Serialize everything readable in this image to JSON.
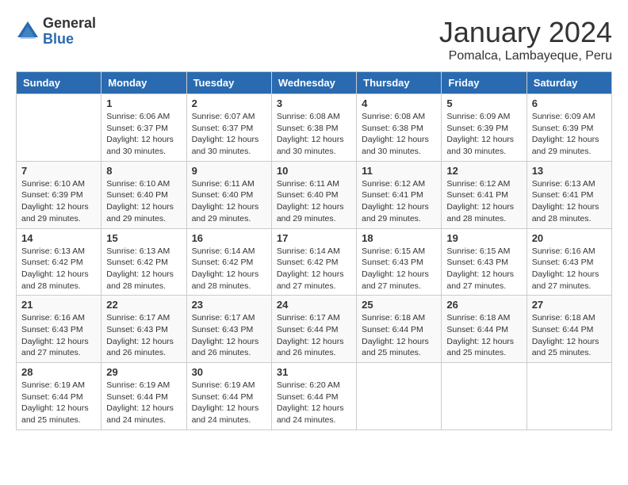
{
  "logo": {
    "general": "General",
    "blue": "Blue"
  },
  "title": "January 2024",
  "subtitle": "Pomalca, Lambayeque, Peru",
  "headers": [
    "Sunday",
    "Monday",
    "Tuesday",
    "Wednesday",
    "Thursday",
    "Friday",
    "Saturday"
  ],
  "weeks": [
    [
      {
        "day": "",
        "info": ""
      },
      {
        "day": "1",
        "info": "Sunrise: 6:06 AM\nSunset: 6:37 PM\nDaylight: 12 hours\nand 30 minutes."
      },
      {
        "day": "2",
        "info": "Sunrise: 6:07 AM\nSunset: 6:37 PM\nDaylight: 12 hours\nand 30 minutes."
      },
      {
        "day": "3",
        "info": "Sunrise: 6:08 AM\nSunset: 6:38 PM\nDaylight: 12 hours\nand 30 minutes."
      },
      {
        "day": "4",
        "info": "Sunrise: 6:08 AM\nSunset: 6:38 PM\nDaylight: 12 hours\nand 30 minutes."
      },
      {
        "day": "5",
        "info": "Sunrise: 6:09 AM\nSunset: 6:39 PM\nDaylight: 12 hours\nand 30 minutes."
      },
      {
        "day": "6",
        "info": "Sunrise: 6:09 AM\nSunset: 6:39 PM\nDaylight: 12 hours\nand 29 minutes."
      }
    ],
    [
      {
        "day": "7",
        "info": "Sunrise: 6:10 AM\nSunset: 6:39 PM\nDaylight: 12 hours\nand 29 minutes."
      },
      {
        "day": "8",
        "info": "Sunrise: 6:10 AM\nSunset: 6:40 PM\nDaylight: 12 hours\nand 29 minutes."
      },
      {
        "day": "9",
        "info": "Sunrise: 6:11 AM\nSunset: 6:40 PM\nDaylight: 12 hours\nand 29 minutes."
      },
      {
        "day": "10",
        "info": "Sunrise: 6:11 AM\nSunset: 6:40 PM\nDaylight: 12 hours\nand 29 minutes."
      },
      {
        "day": "11",
        "info": "Sunrise: 6:12 AM\nSunset: 6:41 PM\nDaylight: 12 hours\nand 29 minutes."
      },
      {
        "day": "12",
        "info": "Sunrise: 6:12 AM\nSunset: 6:41 PM\nDaylight: 12 hours\nand 28 minutes."
      },
      {
        "day": "13",
        "info": "Sunrise: 6:13 AM\nSunset: 6:41 PM\nDaylight: 12 hours\nand 28 minutes."
      }
    ],
    [
      {
        "day": "14",
        "info": "Sunrise: 6:13 AM\nSunset: 6:42 PM\nDaylight: 12 hours\nand 28 minutes."
      },
      {
        "day": "15",
        "info": "Sunrise: 6:13 AM\nSunset: 6:42 PM\nDaylight: 12 hours\nand 28 minutes."
      },
      {
        "day": "16",
        "info": "Sunrise: 6:14 AM\nSunset: 6:42 PM\nDaylight: 12 hours\nand 28 minutes."
      },
      {
        "day": "17",
        "info": "Sunrise: 6:14 AM\nSunset: 6:42 PM\nDaylight: 12 hours\nand 27 minutes."
      },
      {
        "day": "18",
        "info": "Sunrise: 6:15 AM\nSunset: 6:43 PM\nDaylight: 12 hours\nand 27 minutes."
      },
      {
        "day": "19",
        "info": "Sunrise: 6:15 AM\nSunset: 6:43 PM\nDaylight: 12 hours\nand 27 minutes."
      },
      {
        "day": "20",
        "info": "Sunrise: 6:16 AM\nSunset: 6:43 PM\nDaylight: 12 hours\nand 27 minutes."
      }
    ],
    [
      {
        "day": "21",
        "info": "Sunrise: 6:16 AM\nSunset: 6:43 PM\nDaylight: 12 hours\nand 27 minutes."
      },
      {
        "day": "22",
        "info": "Sunrise: 6:17 AM\nSunset: 6:43 PM\nDaylight: 12 hours\nand 26 minutes."
      },
      {
        "day": "23",
        "info": "Sunrise: 6:17 AM\nSunset: 6:43 PM\nDaylight: 12 hours\nand 26 minutes."
      },
      {
        "day": "24",
        "info": "Sunrise: 6:17 AM\nSunset: 6:44 PM\nDaylight: 12 hours\nand 26 minutes."
      },
      {
        "day": "25",
        "info": "Sunrise: 6:18 AM\nSunset: 6:44 PM\nDaylight: 12 hours\nand 25 minutes."
      },
      {
        "day": "26",
        "info": "Sunrise: 6:18 AM\nSunset: 6:44 PM\nDaylight: 12 hours\nand 25 minutes."
      },
      {
        "day": "27",
        "info": "Sunrise: 6:18 AM\nSunset: 6:44 PM\nDaylight: 12 hours\nand 25 minutes."
      }
    ],
    [
      {
        "day": "28",
        "info": "Sunrise: 6:19 AM\nSunset: 6:44 PM\nDaylight: 12 hours\nand 25 minutes."
      },
      {
        "day": "29",
        "info": "Sunrise: 6:19 AM\nSunset: 6:44 PM\nDaylight: 12 hours\nand 24 minutes."
      },
      {
        "day": "30",
        "info": "Sunrise: 6:19 AM\nSunset: 6:44 PM\nDaylight: 12 hours\nand 24 minutes."
      },
      {
        "day": "31",
        "info": "Sunrise: 6:20 AM\nSunset: 6:44 PM\nDaylight: 12 hours\nand 24 minutes."
      },
      {
        "day": "",
        "info": ""
      },
      {
        "day": "",
        "info": ""
      },
      {
        "day": "",
        "info": ""
      }
    ]
  ]
}
